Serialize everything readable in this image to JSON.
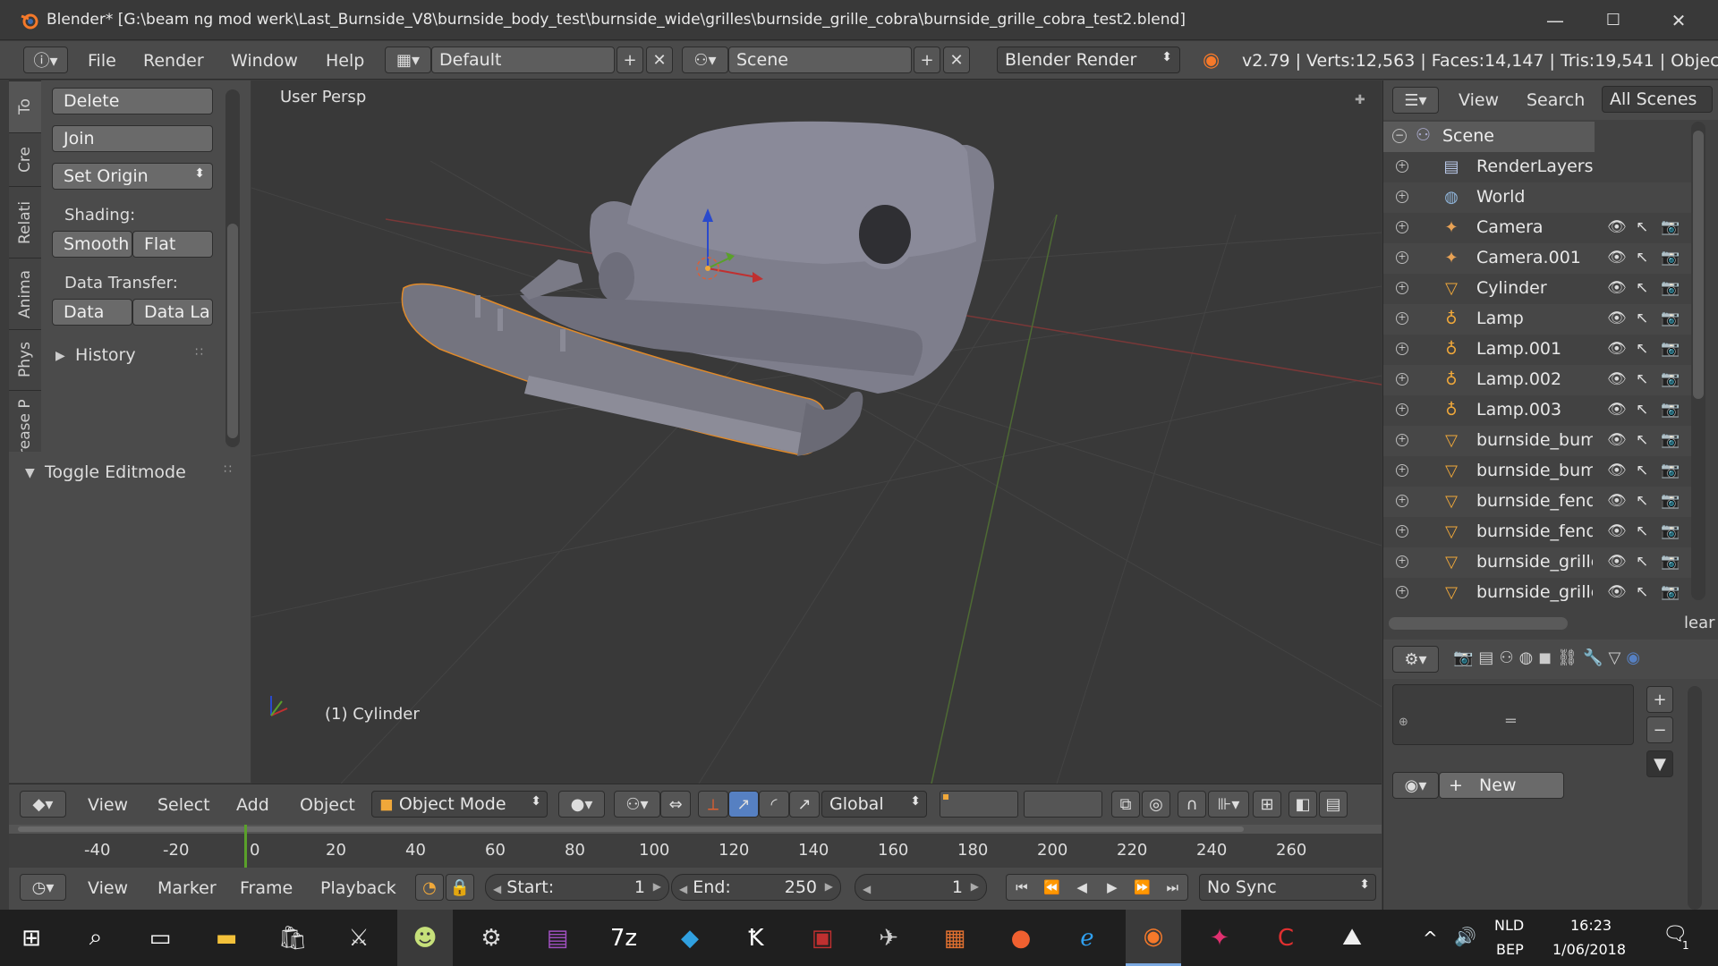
{
  "window": {
    "title": "Blender* [G:\\beam ng mod werk\\Last_Burnside_V8\\burnside_body_test\\burnside_wide\\grilles\\burnside_grille_cobra\\burnside_grille_cobra_test2.blend]",
    "minimize": "—",
    "maximize": "☐",
    "close": "✕"
  },
  "info": {
    "menus": [
      "File",
      "Render",
      "Window",
      "Help"
    ],
    "layout": "Default",
    "scene": "Scene",
    "engine": "Blender Render",
    "stats": "v2.79 | Verts:12,563 | Faces:14,147 | Tris:19,541 | Objec"
  },
  "tool_tabs": [
    "To",
    "Cre",
    "Relati",
    "Anima",
    "Phys",
    "Grease P"
  ],
  "tools": {
    "delete": "Delete",
    "join": "Join",
    "set_origin": "Set Origin",
    "shading_label": "Shading:",
    "smooth": "Smooth",
    "flat": "Flat",
    "data_transfer_label": "Data Transfer:",
    "data": "Data",
    "data_layers": "Data La",
    "history": "History",
    "toggle_editmode": "Toggle Editmode"
  },
  "viewport": {
    "persp_label": "User Persp",
    "active_object": "(1) Cylinder"
  },
  "view3d_header": {
    "menus": [
      "View",
      "Select",
      "Add",
      "Object"
    ],
    "mode": "Object Mode",
    "orientation": "Global"
  },
  "timeline": {
    "ticks": [
      "-40",
      "-20",
      "0",
      "20",
      "40",
      "60",
      "80",
      "100",
      "120",
      "140",
      "160",
      "180",
      "200",
      "220",
      "240",
      "260"
    ],
    "menus": [
      "View",
      "Marker",
      "Frame",
      "Playback"
    ],
    "start_label": "Start:",
    "start": "1",
    "end_label": "End:",
    "end": "250",
    "current": "1",
    "sync": "No Sync"
  },
  "outliner": {
    "menus": [
      "View",
      "Search"
    ],
    "filter": "All Scenes",
    "scene": "Scene",
    "items": [
      {
        "name": "RenderLayers",
        "icon": "renderlayers-icon",
        "glyph": "▤",
        "color": "#b9c8e8"
      },
      {
        "name": "World",
        "icon": "world-icon",
        "glyph": "◍",
        "color": "#8fb4d9"
      },
      {
        "name": "Camera",
        "icon": "camera-icon",
        "glyph": "✦",
        "color": "#e8a255"
      },
      {
        "name": "Camera.001",
        "icon": "camera-icon",
        "glyph": "✦",
        "color": "#e8a255"
      },
      {
        "name": "Cylinder",
        "icon": "mesh-icon",
        "glyph": "▽",
        "color": "#f0a83a"
      },
      {
        "name": "Lamp",
        "icon": "lamp-icon",
        "glyph": "♁",
        "color": "#f0a83a"
      },
      {
        "name": "Lamp.001",
        "icon": "lamp-icon",
        "glyph": "♁",
        "color": "#f0a83a"
      },
      {
        "name": "Lamp.002",
        "icon": "lamp-icon",
        "glyph": "♁",
        "color": "#f0a83a"
      },
      {
        "name": "Lamp.003",
        "icon": "lamp-icon",
        "glyph": "♁",
        "color": "#f0a83a"
      },
      {
        "name": "burnside_bum",
        "icon": "mesh-icon",
        "glyph": "▽",
        "color": "#f0a83a"
      },
      {
        "name": "burnside_bum",
        "icon": "mesh-icon",
        "glyph": "▽",
        "color": "#f0a83a"
      },
      {
        "name": "burnside_fend",
        "icon": "mesh-icon",
        "glyph": "▽",
        "color": "#f0a83a"
      },
      {
        "name": "burnside_fend",
        "icon": "mesh-icon",
        "glyph": "▽",
        "color": "#f0a83a"
      },
      {
        "name": "burnside_grille",
        "icon": "mesh-icon",
        "glyph": "▽",
        "color": "#f0a83a"
      },
      {
        "name": "burnside_grille",
        "icon": "mesh-icon",
        "glyph": "▽",
        "color": "#f0a83a"
      }
    ],
    "overflow_text": "lear"
  },
  "properties": {
    "new_button": "New"
  },
  "taskbar": {
    "lang": "NLD",
    "kb": "BEP",
    "time": "16:23",
    "date": "1/06/2018",
    "notifications": "1"
  },
  "colors": {
    "accent_orange": "#f0a83a",
    "selected_outline": "#e08a2a",
    "axis_x": "#c03030",
    "axis_y": "#5aa02a",
    "axis_z": "#2a4acc"
  }
}
